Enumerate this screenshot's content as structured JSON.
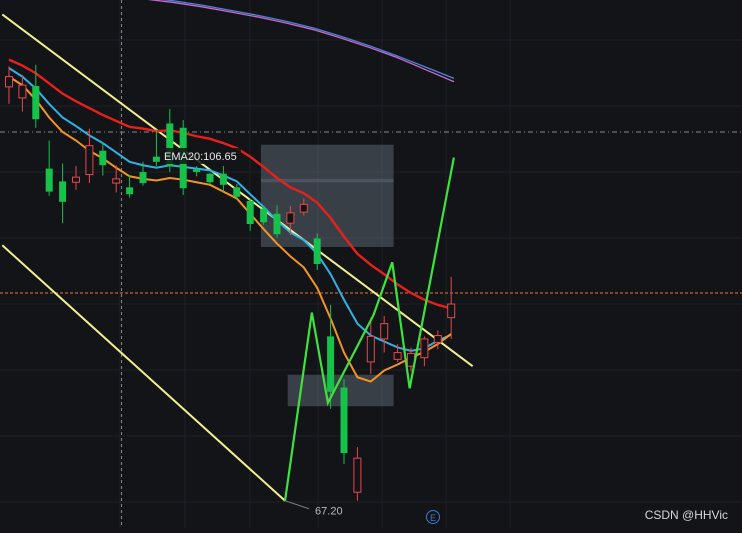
{
  "chart_data": {
    "type": "candlestick",
    "ylim": [
      64,
      126
    ],
    "x_count": 34,
    "ema_label": "EMA20:106.65",
    "low_label": "67.20",
    "crosshair_y": 110.5,
    "dashed_level": 91.6,
    "candles": [
      {
        "o": 115.8,
        "h": 118.2,
        "l": 113.8,
        "c": 117.0
      },
      {
        "o": 114.5,
        "h": 117.2,
        "l": 112.9,
        "c": 116.0
      },
      {
        "o": 115.9,
        "h": 118.4,
        "l": 111.0,
        "c": 112.0
      },
      {
        "o": 106.2,
        "h": 109.5,
        "l": 103.0,
        "c": 103.5
      },
      {
        "o": 104.7,
        "h": 106.8,
        "l": 99.8,
        "c": 102.3
      },
      {
        "o": 104.6,
        "h": 106.5,
        "l": 103.7,
        "c": 105.2
      },
      {
        "o": 105.5,
        "h": 110.9,
        "l": 104.5,
        "c": 108.9
      },
      {
        "o": 108.3,
        "h": 109.3,
        "l": 105.4,
        "c": 106.6
      },
      {
        "o": 104.5,
        "h": 106.6,
        "l": 103.4,
        "c": 105.0
      },
      {
        "o": 104.0,
        "h": 105.4,
        "l": 102.8,
        "c": 103.2
      },
      {
        "o": 105.8,
        "h": 107.0,
        "l": 104.2,
        "c": 104.5
      },
      {
        "o": 107.6,
        "h": 110.8,
        "l": 106.5,
        "c": 107.0
      },
      {
        "o": 111.5,
        "h": 113.2,
        "l": 105.8,
        "c": 106.5
      },
      {
        "o": 111.0,
        "h": 111.9,
        "l": 103.1,
        "c": 103.9
      },
      {
        "o": 106.1,
        "h": 106.5,
        "l": 105.3,
        "c": 105.8
      },
      {
        "o": 105.6,
        "h": 105.7,
        "l": 104.4,
        "c": 104.6
      },
      {
        "o": 105.6,
        "h": 106.5,
        "l": 103.5,
        "c": 104.3
      },
      {
        "o": 104.0,
        "h": 104.4,
        "l": 102.6,
        "c": 102.9
      },
      {
        "o": 102.4,
        "h": 102.7,
        "l": 98.9,
        "c": 99.7
      },
      {
        "o": 101.5,
        "h": 101.8,
        "l": 99.6,
        "c": 99.9
      },
      {
        "o": 100.9,
        "h": 101.9,
        "l": 98.1,
        "c": 98.5
      },
      {
        "o": 99.8,
        "h": 101.8,
        "l": 98.4,
        "c": 101.0
      },
      {
        "o": 101.1,
        "h": 102.7,
        "l": 100.7,
        "c": 102.0
      },
      {
        "o": 98.0,
        "h": 98.6,
        "l": 94.3,
        "c": 95.0
      },
      {
        "o": 86.5,
        "h": 90.2,
        "l": 78.0,
        "c": 80.0
      },
      {
        "o": 80.5,
        "h": 81.5,
        "l": 71.5,
        "c": 72.8
      },
      {
        "o": 68.2,
        "h": 73.5,
        "l": 67.2,
        "c": 72.2
      },
      {
        "o": 83.5,
        "h": 88.7,
        "l": 82.1,
        "c": 86.5
      },
      {
        "o": 86.2,
        "h": 88.9,
        "l": 84.6,
        "c": 88.0
      },
      {
        "o": 83.8,
        "h": 85.6,
        "l": 83.5,
        "c": 84.6
      },
      {
        "o": 83.0,
        "h": 85.2,
        "l": 82.4,
        "c": 84.5
      },
      {
        "o": 84.0,
        "h": 86.5,
        "l": 83.0,
        "c": 86.2
      },
      {
        "o": 85.8,
        "h": 87.2,
        "l": 85.0,
        "c": 86.6
      },
      {
        "o": 88.7,
        "h": 93.5,
        "l": 86.2,
        "c": 90.3
      }
    ],
    "candle_x_offset": 0,
    "ema_red": [
      119,
      118.3,
      117.4,
      116.2,
      115.0,
      114.1,
      113.3,
      112.5,
      111.8,
      111.1,
      110.9,
      110.6,
      110.7,
      110.4,
      110.0,
      109.7,
      109.2,
      108.6,
      107.6,
      106.4,
      105.1,
      104.0,
      103.3,
      102.2,
      100.4,
      98.2,
      96.2,
      94.9,
      93.8,
      92.6,
      91.6,
      90.8,
      90.2,
      89.8
    ],
    "ema_blue": [
      118,
      117.0,
      115.6,
      113.8,
      112.2,
      111.2,
      110.1,
      109.2,
      108.1,
      107.0,
      106.6,
      106.3,
      106.6,
      106.4,
      106.2,
      106.0,
      105.4,
      104.7,
      103.2,
      101.7,
      100.1,
      98.7,
      97.8,
      96.2,
      93.8,
      90.8,
      88.0,
      86.6,
      85.9,
      85.2,
      84.8,
      85.1,
      86.0,
      86.7
    ],
    "ema_orange": [
      117,
      116.0,
      114.3,
      112.2,
      110.5,
      109.5,
      108.3,
      107.4,
      106.3,
      105.3,
      105.0,
      104.8,
      105.1,
      104.9,
      104.6,
      104.3,
      103.5,
      102.7,
      100.9,
      99.1,
      97.4,
      95.9,
      94.6,
      92.2,
      88.6,
      84.6,
      81.7,
      81.2,
      82.5,
      83.2,
      84.0,
      84.7,
      85.6,
      86.8
    ],
    "ema_long_pink": [
      126.8,
      126.5,
      126.1,
      125.7,
      125.2,
      124.6,
      124.0,
      123.3,
      122.5,
      121.5,
      120.4,
      119.2,
      117.8,
      116.4
    ],
    "ema_long_blue": [
      127.0,
      126.7,
      126.3,
      125.9,
      125.4,
      124.8,
      124.2,
      123.5,
      122.7,
      121.7,
      120.6,
      119.4,
      118.1,
      116.8
    ],
    "channel_upper": [
      [
        -0.5,
        124.3
      ],
      [
        34.6,
        83.0
      ]
    ],
    "channel_lower": [
      [
        -0.5,
        97.2
      ],
      [
        20.6,
        67.2
      ]
    ],
    "zone_upper": {
      "x0": 18.8,
      "x1": 28.7,
      "y0": 97.0,
      "y1": 109.0
    },
    "zone_mid_thin": {
      "x0": 18.8,
      "x1": 28.7,
      "y0": 104.6,
      "y1": 105.0
    },
    "zone_lower": {
      "x0": 20.8,
      "x1": 28.7,
      "y0": 78.3,
      "y1": 82.0
    },
    "projection": [
      [
        20.6,
        67.2
      ],
      [
        22.6,
        89.3
      ],
      [
        23.8,
        78.7
      ],
      [
        27.2,
        89.0
      ],
      [
        28.6,
        95.2
      ],
      [
        29.9,
        80.4
      ],
      [
        33.2,
        107.5
      ]
    ]
  },
  "watermark": "CSDN @HHVic"
}
